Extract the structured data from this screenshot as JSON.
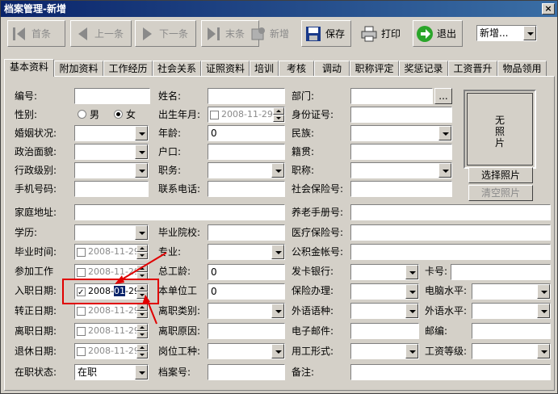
{
  "window": {
    "title": "档案管理-新增",
    "close": "×"
  },
  "toolbar": {
    "first": "首条",
    "prev": "上一条",
    "next": "下一条",
    "last": "末条",
    "add": "新增",
    "save": "保存",
    "print": "打印",
    "exit": "退出",
    "mode": "新增..."
  },
  "tabs": [
    "基本资料",
    "附加资料",
    "工作经历",
    "社会关系",
    "证照资料",
    "培训",
    "考核",
    "调动",
    "职称评定",
    "奖惩记录",
    "工资晋升",
    "物品领用"
  ],
  "form": {
    "bianhao": "编号:",
    "xingming": "姓名:",
    "bumen": "部门:",
    "browse": "...",
    "xingbie": "性别:",
    "male": "男",
    "female": "女",
    "chusheng": "出生年月:",
    "shenfen": "身份证号:",
    "hunyin": "婚姻状况:",
    "nianling": "年龄:",
    "nianling_val": "0",
    "minzu": "民族:",
    "zhengzhi": "政治面貌:",
    "hukou": "户口:",
    "jiguan": "籍贯:",
    "xingzheng": "行政级别:",
    "zhiwu": "职务:",
    "zhicheng": "职称:",
    "shouji": "手机号码:",
    "lianxi": "联系电话:",
    "shebao": "社会保险号:",
    "jiating": "家庭地址:",
    "yanglao": "养老手册号:",
    "xueli": "学历:",
    "yuanxiao": "毕业院校:",
    "yiliao": "医疗保险号:",
    "biye": "毕业时间:",
    "zhuanye": "专业:",
    "gongjijin": "公积金帐号:",
    "canjia": "参加工作",
    "zonggongling": "总工龄:",
    "zonggongling_val": "0",
    "fakayinhang": "发卡银行:",
    "kahao": "卡号:",
    "ruzhi": "入职日期:",
    "benbanwei": "本单位工",
    "benbanwei_val": "0",
    "baoxian": "保险办理:",
    "diannao": "电脑水平:",
    "zhuanzheng": "转正日期:",
    "lizhileibie": "离职类别:",
    "waiyuyu": "外语语种:",
    "waiyushui": "外语水平:",
    "lizhiriqi": "离职日期:",
    "lizhiyuanyin": "离职原因:",
    "youjian": "电子邮件:",
    "youbian": "邮编:",
    "tuixiu": "退休日期:",
    "gangwei": "岗位工种:",
    "yonggong": "用工形式:",
    "gongzi": "工资等级:",
    "zaizhi": "在职状态:",
    "zaizhi_val": "在职",
    "danganhao": "档案号:",
    "beizhu": "备注:"
  },
  "dates": {
    "default": "2008-11-29",
    "ruzhi_y": "2008-",
    "ruzhi_m": "01",
    "ruzhi_d": "-29"
  },
  "photo": {
    "none": "无\n照\n片",
    "choose": "选择照片",
    "clear": "清空照片"
  }
}
